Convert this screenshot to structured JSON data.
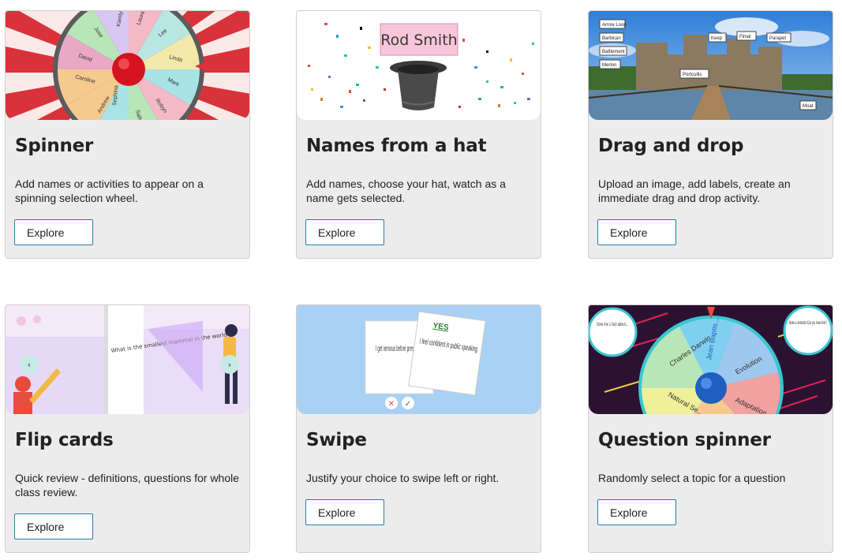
{
  "cards": [
    {
      "title": "Spinner",
      "description": "Add names or activities to appear on a spinning selection wheel.",
      "button": "Explore"
    },
    {
      "title": "Names from a hat",
      "description": "Add names, choose your hat, watch as a name gets selected.",
      "button": "Explore"
    },
    {
      "title": "Drag and drop",
      "description": "Upload an image, add labels, create an immediate drag and drop activity.",
      "button": "Explore"
    },
    {
      "title": "Flip cards",
      "description": "Quick review - definitions, questions for whole class review.",
      "button": "Explore"
    },
    {
      "title": "Swipe",
      "description": "Justify your choice to swipe left or right.",
      "button": "Explore"
    },
    {
      "title": "Question spinner",
      "description": "Randomly select a topic for a question",
      "button": "Explore"
    }
  ],
  "thumbnails": {
    "spinner_names": [
      "Kamlyn",
      "Laura",
      "Lee",
      "Linda",
      "Mark",
      "Robyn",
      "Sally",
      "Sephina",
      "Andrew",
      "Caroline",
      "David",
      "Jose"
    ],
    "hat_name": "Rod Smith",
    "drag_labels": [
      "Arrow Loop",
      "Barbican",
      "Battlement",
      "Merlon",
      "Keep",
      "Finial",
      "Parapet",
      "Portcullis",
      "Moat"
    ],
    "flip_text": "What is the smallest mammal in the world?",
    "swipe_back_text": "I get nervous before presenting",
    "swipe_front_text": "I feel confident in public speaking",
    "swipe_badge": "YES",
    "q_left_bubble": "Give me 1 fact about...",
    "q_right_bubble": "Make a connection Can you make links?",
    "q_topics": [
      "Jean Baptis...",
      "Evolution",
      "Adaptation",
      "Natural Se...",
      "Charles Darwin"
    ]
  },
  "colors": {
    "button_border": "#2a7dab",
    "card_bg": "#ececec"
  }
}
